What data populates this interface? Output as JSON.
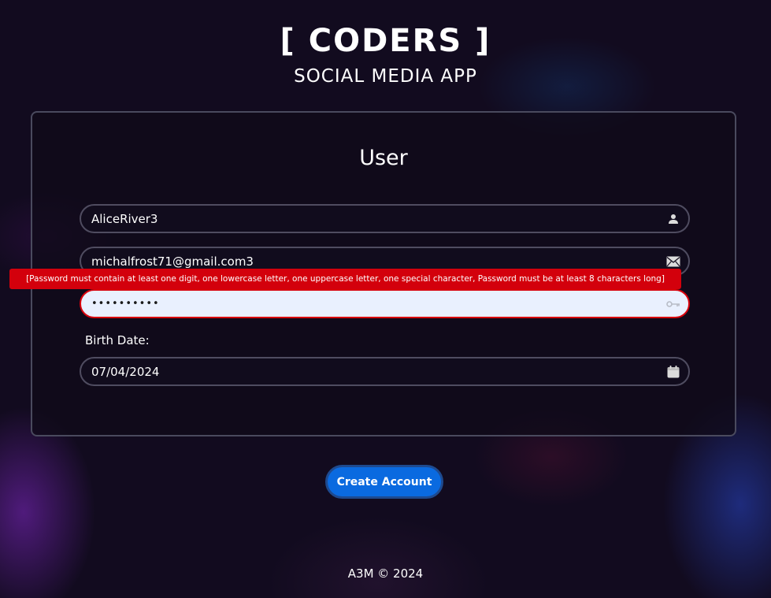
{
  "header": {
    "title": "[ CODERS ]",
    "subtitle": "SOCIAL MEDIA APP"
  },
  "form": {
    "title": "User",
    "username": {
      "value": "AliceRiver3",
      "icon": "user-icon"
    },
    "email": {
      "value": "michalfrost71@gmail.com3",
      "icon": "envelope-icon"
    },
    "password": {
      "value": "••••••••••",
      "icon": "key-icon",
      "error": "[Password must contain at least one digit, one lowercase letter, one uppercase letter, one special character, Password must be at least 8 characters long]"
    },
    "birth_date": {
      "label": "Birth Date:",
      "value": "07/04/2024",
      "icon": "calendar-icon"
    }
  },
  "actions": {
    "create_label": "Create Account"
  },
  "footer": {
    "text": "A3M © 2024"
  },
  "colors": {
    "background": "#120b1f",
    "button": "#0a6ae0",
    "error": "#d3000c",
    "password_fill": "#e9f0fe"
  }
}
